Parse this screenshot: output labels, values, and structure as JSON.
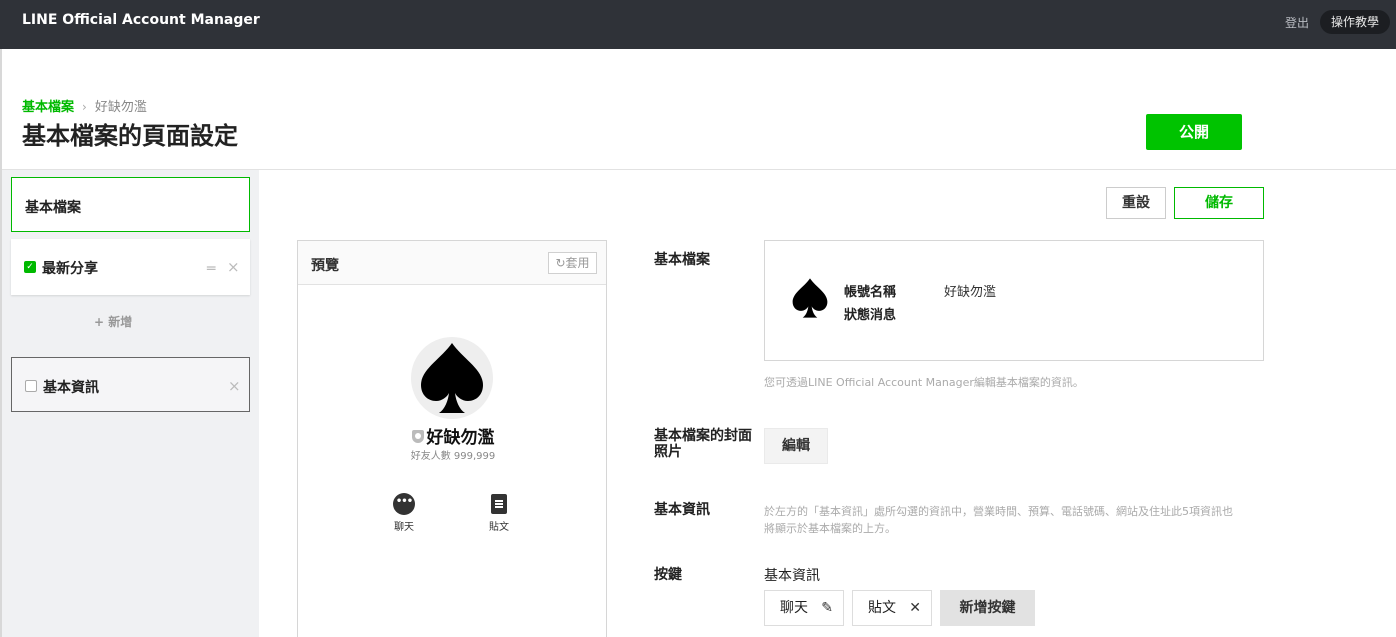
{
  "topbar": {
    "brand_line": "LINE",
    "brand_rest": "Official Account Manager",
    "logout_label": "登出",
    "help_label": "操作教學"
  },
  "header": {
    "breadcrumb_link": "基本檔案",
    "breadcrumb_current": "好缺勿濫",
    "title": "基本檔案的頁面設定",
    "publish_label": "公開"
  },
  "sidebar": {
    "items": [
      {
        "label": "基本檔案",
        "active": true
      },
      {
        "label": "最新分享",
        "checked": true
      },
      {
        "label": "基本資訊",
        "checked": false
      }
    ],
    "add_label": "+ 新增",
    "remove_glyph": "×"
  },
  "actions": {
    "reset_label": "重設",
    "save_label": "儲存"
  },
  "preview": {
    "title": "預覽",
    "apply_label": "↻套用",
    "account_name": "好缺勿濫",
    "friends_text": "好友人數 999,999",
    "chat_label": "聊天",
    "post_label": "貼文"
  },
  "fields": {
    "profile_label": "基本檔案",
    "account_name_label": "帳號名稱",
    "account_name_value": "好缺勿濫",
    "status_label": "狀態消息",
    "profile_note": "您可透過LINE Official Account Manager編輯基本檔案的資訊。",
    "cover_label_line1": "基本檔案的封面",
    "cover_label_line2": "照片",
    "edit_label": "編輯",
    "basic_info_label": "基本資訊",
    "basic_info_note_line1": "於左方的「基本資訊」處所勾選的資訊中，營業時間、預算、電話號碼、網站及住址此5項資訊也",
    "basic_info_note_line2": "將顯示於基本檔案的上方。",
    "buttons_label": "按鍵",
    "buttons_sub": "基本資訊",
    "chip_chat": "聊天",
    "chip_post": "貼文",
    "add_button_label": "新增按鍵"
  },
  "colors": {
    "brand_green": "#00b900",
    "topbar_bg": "#2f3238"
  }
}
